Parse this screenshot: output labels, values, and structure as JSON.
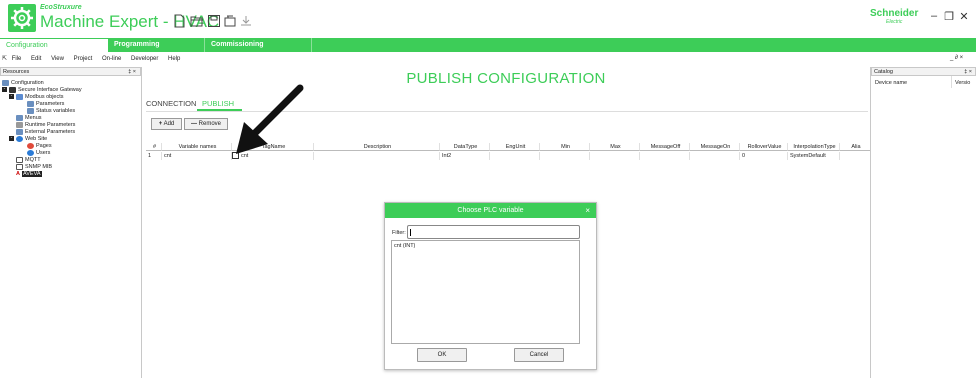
{
  "app": {
    "brand_small": "EcoStruxure",
    "title_bold": "Machine Expert",
    "title_light": " - HVAC",
    "vendor": "Schneider",
    "vendor_sub": "Electric",
    "window_min": "–",
    "window_max": "❐",
    "window_close": "✕"
  },
  "tabs": [
    {
      "label": "Configuration"
    },
    {
      "label": "Programming"
    },
    {
      "label": "Commissioning"
    }
  ],
  "menu": [
    "File",
    "Edit",
    "View",
    "Project",
    "On-line",
    "Developer",
    "Help"
  ],
  "menu_right": "_ ∂ ×",
  "resources": {
    "title": "Resources",
    "pin": "‡ ×",
    "items": [
      {
        "label": "Configuration",
        "icon": "config-icon",
        "color": "#6a8fbf"
      },
      {
        "label": "Secure Interface Gateway",
        "icon": "gateway-icon",
        "color": "#333"
      },
      {
        "label": "Modbus objects",
        "icon": "modbus-icon",
        "color": "#5b8bd0"
      },
      {
        "label": "Parameters",
        "icon": "table-icon",
        "color": "#6a8fbf"
      },
      {
        "label": "Status variables",
        "icon": "status-icon",
        "color": "#6a8fbf"
      },
      {
        "label": "Menus",
        "icon": "menus-icon",
        "color": "#6a8fbf"
      },
      {
        "label": "Runtime Parameters",
        "icon": "runtime-icon",
        "color": "#999"
      },
      {
        "label": "External Parameters",
        "icon": "external-icon",
        "color": "#6a8fbf"
      },
      {
        "label": "Web Site",
        "icon": "globe-icon",
        "color": "#2b7bd6"
      },
      {
        "label": "Pages",
        "icon": "pages-icon",
        "color": "#e04a3a"
      },
      {
        "label": "Users",
        "icon": "users-icon",
        "color": "#2b7bd6"
      },
      {
        "label": "MQTT",
        "icon": "mqtt-icon",
        "color": "#555"
      },
      {
        "label": "SNMP MIB",
        "icon": "snmp-icon",
        "color": "#555"
      },
      {
        "label": "AVEVA",
        "icon": "aveva-icon",
        "color": "#c00"
      }
    ]
  },
  "catalog": {
    "title": "Catalog",
    "pin": "‡ ×",
    "col1": "Device name",
    "col2": "Versio"
  },
  "main": {
    "title": "PUBLISH CONFIGURATION",
    "subtabs": [
      "CONNECTION",
      "PUBLISH"
    ],
    "add_label": "Add",
    "remove_label": "Remove",
    "columns": [
      "#",
      "Variable names",
      "TagName",
      "Description",
      "DataType",
      "EngUnit",
      "Min",
      "Max",
      "MessageOff",
      "MessageOn",
      "RolloverValue",
      "InterpolationType",
      "Alia"
    ],
    "rows": [
      [
        "1",
        "cnt",
        "cnt",
        "",
        "Int2",
        "",
        "",
        "",
        "",
        "",
        "0",
        "SystemDefault",
        ""
      ]
    ]
  },
  "dialog": {
    "title": "Choose PLC variable",
    "close": "×",
    "filter_label": "Filter:",
    "filter_value": "",
    "items": [
      "cnt (INT)"
    ],
    "ok": "OK",
    "cancel": "Cancel"
  },
  "colors": {
    "accent": "#3dcd58"
  }
}
